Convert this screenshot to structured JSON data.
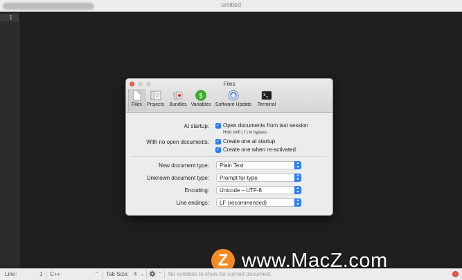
{
  "window": {
    "title": "untitled"
  },
  "gutter": {
    "line_number": "1"
  },
  "status": {
    "line_label": "Line:",
    "line_value": "1",
    "language": "C++",
    "tab_size_label": "Tab Size:",
    "tab_size_value": "4",
    "symbol_text": "No symbols to show for current document."
  },
  "prefs": {
    "title": "Files",
    "tabs": [
      {
        "label": "Files",
        "icon": "files-icon"
      },
      {
        "label": "Projects",
        "icon": "projects-icon"
      },
      {
        "label": "Bundles",
        "icon": "bundles-icon"
      },
      {
        "label": "Variables",
        "icon": "variables-icon"
      },
      {
        "label": "Software Update",
        "icon": "software-update-icon"
      },
      {
        "label": "Terminal",
        "icon": "terminal-icon"
      }
    ],
    "startup_label": "At startup:",
    "startup_option": "Open documents from last session",
    "startup_hint": "Hold shift (⇧) to bypass",
    "no_docs_label": "With no open documents:",
    "no_docs_option1": "Create one at startup",
    "no_docs_option2": "Create one when re-activated",
    "new_doc_label": "New document type:",
    "new_doc_value": "Plain Text",
    "unknown_label": "Unknown document type:",
    "unknown_value": "Prompt for type",
    "encoding_label": "Encoding:",
    "encoding_value": "Unicode – UTF-8",
    "line_endings_label": "Line endings:",
    "line_endings_value": "LF (recommended)"
  },
  "watermark": {
    "logo": "Z",
    "text": "www.MacZ.com"
  }
}
